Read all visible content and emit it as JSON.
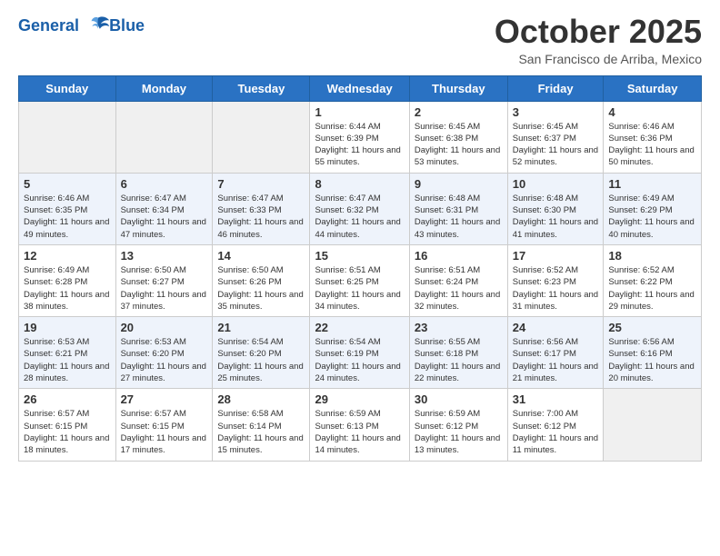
{
  "header": {
    "logo_line1": "General",
    "logo_line2": "Blue",
    "month": "October 2025",
    "location": "San Francisco de Arriba, Mexico"
  },
  "weekdays": [
    "Sunday",
    "Monday",
    "Tuesday",
    "Wednesday",
    "Thursday",
    "Friday",
    "Saturday"
  ],
  "weeks": [
    [
      {
        "day": "",
        "empty": true
      },
      {
        "day": "",
        "empty": true
      },
      {
        "day": "",
        "empty": true
      },
      {
        "day": "1",
        "sunrise": "6:44 AM",
        "sunset": "6:39 PM",
        "daylight": "11 hours and 55 minutes."
      },
      {
        "day": "2",
        "sunrise": "6:45 AM",
        "sunset": "6:38 PM",
        "daylight": "11 hours and 53 minutes."
      },
      {
        "day": "3",
        "sunrise": "6:45 AM",
        "sunset": "6:37 PM",
        "daylight": "11 hours and 52 minutes."
      },
      {
        "day": "4",
        "sunrise": "6:46 AM",
        "sunset": "6:36 PM",
        "daylight": "11 hours and 50 minutes."
      }
    ],
    [
      {
        "day": "5",
        "sunrise": "6:46 AM",
        "sunset": "6:35 PM",
        "daylight": "11 hours and 49 minutes."
      },
      {
        "day": "6",
        "sunrise": "6:47 AM",
        "sunset": "6:34 PM",
        "daylight": "11 hours and 47 minutes."
      },
      {
        "day": "7",
        "sunrise": "6:47 AM",
        "sunset": "6:33 PM",
        "daylight": "11 hours and 46 minutes."
      },
      {
        "day": "8",
        "sunrise": "6:47 AM",
        "sunset": "6:32 PM",
        "daylight": "11 hours and 44 minutes."
      },
      {
        "day": "9",
        "sunrise": "6:48 AM",
        "sunset": "6:31 PM",
        "daylight": "11 hours and 43 minutes."
      },
      {
        "day": "10",
        "sunrise": "6:48 AM",
        "sunset": "6:30 PM",
        "daylight": "11 hours and 41 minutes."
      },
      {
        "day": "11",
        "sunrise": "6:49 AM",
        "sunset": "6:29 PM",
        "daylight": "11 hours and 40 minutes."
      }
    ],
    [
      {
        "day": "12",
        "sunrise": "6:49 AM",
        "sunset": "6:28 PM",
        "daylight": "11 hours and 38 minutes."
      },
      {
        "day": "13",
        "sunrise": "6:50 AM",
        "sunset": "6:27 PM",
        "daylight": "11 hours and 37 minutes."
      },
      {
        "day": "14",
        "sunrise": "6:50 AM",
        "sunset": "6:26 PM",
        "daylight": "11 hours and 35 minutes."
      },
      {
        "day": "15",
        "sunrise": "6:51 AM",
        "sunset": "6:25 PM",
        "daylight": "11 hours and 34 minutes."
      },
      {
        "day": "16",
        "sunrise": "6:51 AM",
        "sunset": "6:24 PM",
        "daylight": "11 hours and 32 minutes."
      },
      {
        "day": "17",
        "sunrise": "6:52 AM",
        "sunset": "6:23 PM",
        "daylight": "11 hours and 31 minutes."
      },
      {
        "day": "18",
        "sunrise": "6:52 AM",
        "sunset": "6:22 PM",
        "daylight": "11 hours and 29 minutes."
      }
    ],
    [
      {
        "day": "19",
        "sunrise": "6:53 AM",
        "sunset": "6:21 PM",
        "daylight": "11 hours and 28 minutes."
      },
      {
        "day": "20",
        "sunrise": "6:53 AM",
        "sunset": "6:20 PM",
        "daylight": "11 hours and 27 minutes."
      },
      {
        "day": "21",
        "sunrise": "6:54 AM",
        "sunset": "6:20 PM",
        "daylight": "11 hours and 25 minutes."
      },
      {
        "day": "22",
        "sunrise": "6:54 AM",
        "sunset": "6:19 PM",
        "daylight": "11 hours and 24 minutes."
      },
      {
        "day": "23",
        "sunrise": "6:55 AM",
        "sunset": "6:18 PM",
        "daylight": "11 hours and 22 minutes."
      },
      {
        "day": "24",
        "sunrise": "6:56 AM",
        "sunset": "6:17 PM",
        "daylight": "11 hours and 21 minutes."
      },
      {
        "day": "25",
        "sunrise": "6:56 AM",
        "sunset": "6:16 PM",
        "daylight": "11 hours and 20 minutes."
      }
    ],
    [
      {
        "day": "26",
        "sunrise": "6:57 AM",
        "sunset": "6:15 PM",
        "daylight": "11 hours and 18 minutes."
      },
      {
        "day": "27",
        "sunrise": "6:57 AM",
        "sunset": "6:15 PM",
        "daylight": "11 hours and 17 minutes."
      },
      {
        "day": "28",
        "sunrise": "6:58 AM",
        "sunset": "6:14 PM",
        "daylight": "11 hours and 15 minutes."
      },
      {
        "day": "29",
        "sunrise": "6:59 AM",
        "sunset": "6:13 PM",
        "daylight": "11 hours and 14 minutes."
      },
      {
        "day": "30",
        "sunrise": "6:59 AM",
        "sunset": "6:12 PM",
        "daylight": "11 hours and 13 minutes."
      },
      {
        "day": "31",
        "sunrise": "7:00 AM",
        "sunset": "6:12 PM",
        "daylight": "11 hours and 11 minutes."
      },
      {
        "day": "",
        "empty": true
      }
    ]
  ],
  "labels": {
    "sunrise_prefix": "Sunrise: ",
    "sunset_prefix": "Sunset: ",
    "daylight_prefix": "Daylight: "
  }
}
